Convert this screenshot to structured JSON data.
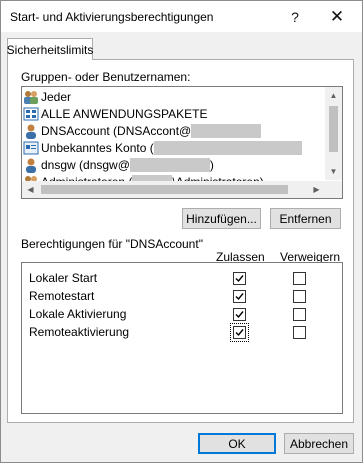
{
  "window": {
    "title": "Start- und Aktivierungsberechtigungen",
    "help_glyph": "?",
    "close_glyph": "✕"
  },
  "tab": {
    "label": "Sicherheitslimits"
  },
  "groups": {
    "label": "Gruppen- oder Benutzernamen:",
    "items": [
      {
        "name": "Jeder",
        "icon": "group-icon"
      },
      {
        "name": "ALLE ANWENDUNGSPAKETE",
        "icon": "app-packages-icon"
      },
      {
        "name": "DNSAccount (DNSAccont@",
        "icon": "user-icon"
      },
      {
        "name": "Unbekanntes Konto (",
        "icon": "unknown-account-icon"
      },
      {
        "name": "dnsgw (dnsgw@",
        "suffix": ")",
        "icon": "user-icon"
      },
      {
        "name": "Administratoren (",
        "suffix": "\\Administratoren)",
        "icon": "group-icon"
      }
    ]
  },
  "buttons": {
    "add": "Hinzufügen...",
    "remove": "Entfernen",
    "ok": "OK",
    "cancel": "Abbrechen"
  },
  "permissions": {
    "label": "Berechtigungen für \"DNSAccount\"",
    "allow_header": "Zulassen",
    "deny_header": "Verweigern",
    "rows": [
      {
        "label": "Lokaler Start",
        "allow": true,
        "deny": false
      },
      {
        "label": "Remotestart",
        "allow": true,
        "deny": false
      },
      {
        "label": "Lokale Aktivierung",
        "allow": true,
        "deny": false
      },
      {
        "label": "Remoteaktivierung",
        "allow": true,
        "deny": false,
        "focused": "allow"
      }
    ]
  }
}
